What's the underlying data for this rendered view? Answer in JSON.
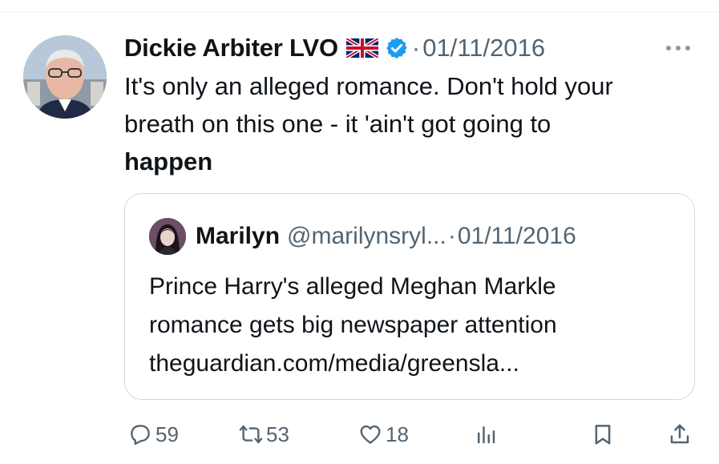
{
  "tweet": {
    "author_name": "Dickie Arbiter LVO",
    "separator": "·",
    "date": "01/11/2016",
    "text_line1": "It's only an alleged romance. Don't hold your",
    "text_line2": "breath on this one - it 'ain't got going to",
    "text_bold": "happen"
  },
  "quote": {
    "author_name": "Marilyn",
    "handle": "@marilynsryl...",
    "separator": "·",
    "date": "01/11/2016",
    "text_line1": "Prince Harry's alleged Meghan Markle",
    "text_line2": "romance gets big newspaper attention",
    "text_line3": "theguardian.com/media/greensla..."
  },
  "actions": {
    "replies": "59",
    "reposts": "53",
    "likes": "18"
  },
  "icons": {
    "flag": "uk-flag-icon",
    "verified": "verified-badge-icon",
    "more": "more-dots-icon",
    "reply": "reply-icon",
    "repost": "repost-icon",
    "like": "heart-icon",
    "views": "views-icon",
    "bookmark": "bookmark-icon",
    "share": "share-icon"
  },
  "colors": {
    "text": "#0f1419",
    "secondary": "#536471",
    "verified": "#1d9bf0",
    "border": "#cfd9de"
  }
}
